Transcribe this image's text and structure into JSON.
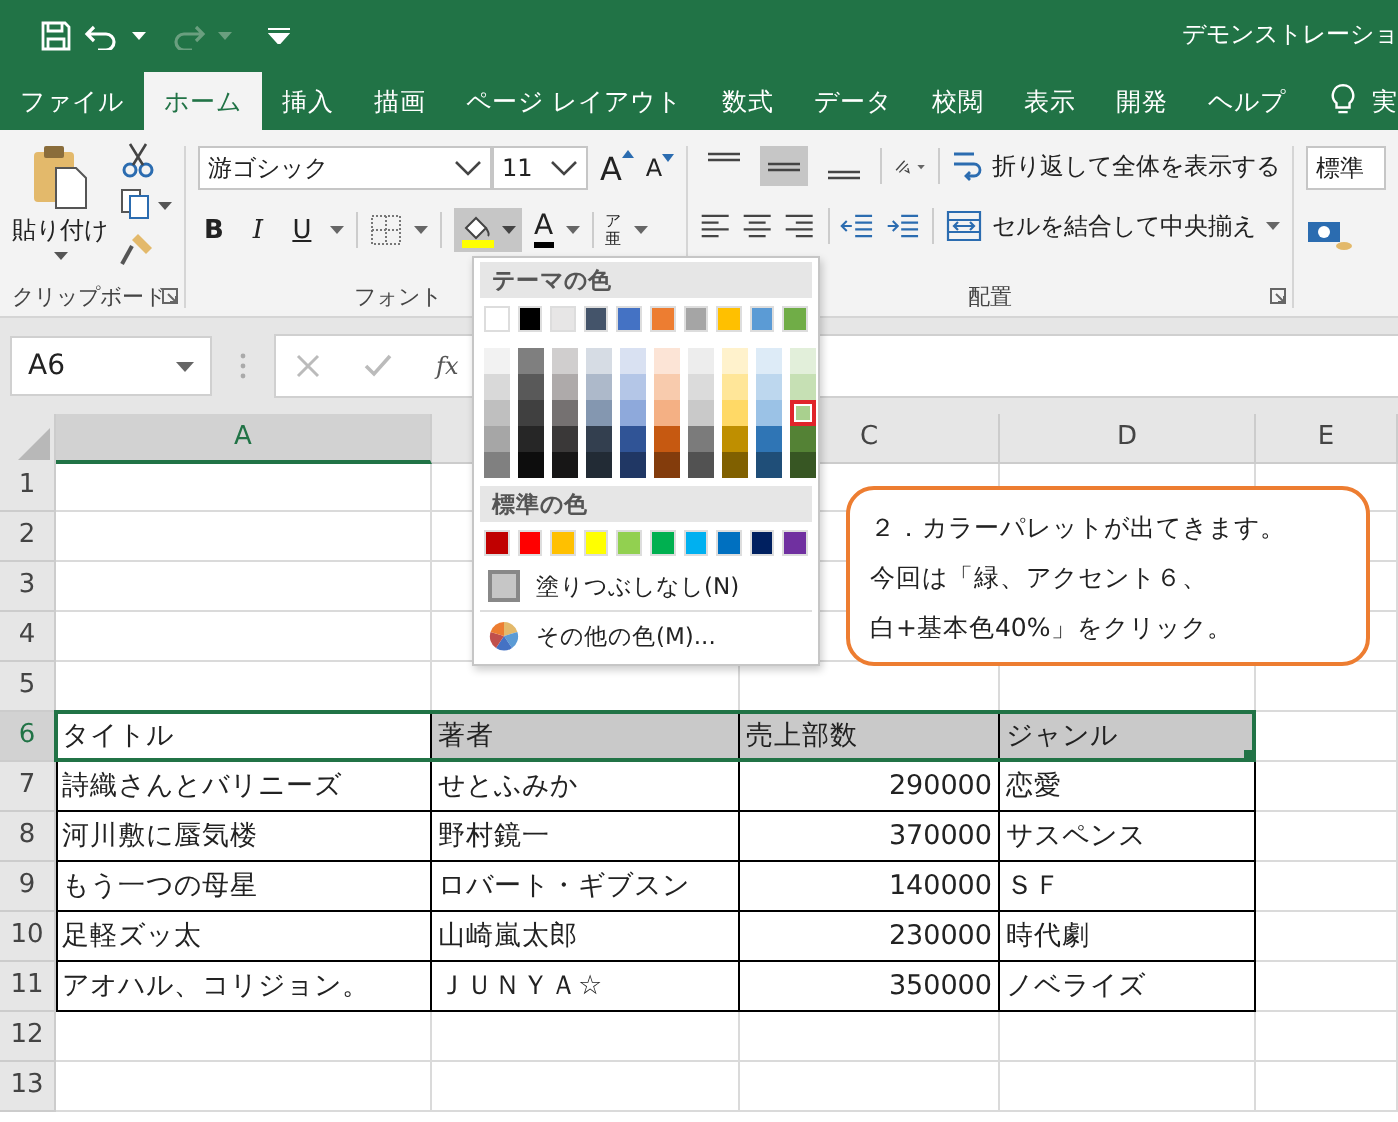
{
  "title_bar": {
    "title": "デモンストレーショ"
  },
  "ribbon_tabs": [
    {
      "label": "ファイル",
      "selected": false
    },
    {
      "label": "ホーム",
      "selected": true
    },
    {
      "label": "挿入",
      "selected": false
    },
    {
      "label": "描画",
      "selected": false
    },
    {
      "label": "ページ レイアウト",
      "selected": false
    },
    {
      "label": "数式",
      "selected": false
    },
    {
      "label": "データ",
      "selected": false
    },
    {
      "label": "校閲",
      "selected": false
    },
    {
      "label": "表示",
      "selected": false
    },
    {
      "label": "開発",
      "selected": false
    },
    {
      "label": "ヘルプ",
      "selected": false
    }
  ],
  "tell_me": "実",
  "ribbon": {
    "clipboard": {
      "paste": "貼り付け",
      "label": "クリップボード"
    },
    "font": {
      "name": "游ゴシック",
      "size": "11",
      "grow": "A",
      "shrink": "A",
      "bold": "B",
      "italic": "I",
      "underline": "U",
      "font_color": "A",
      "phonetic_top": "ア",
      "phonetic_bottom": "亜",
      "fill_menu_open": true,
      "label": "フォント"
    },
    "alignment": {
      "valign_buttons": [
        {
          "kind": "top",
          "selected": false
        },
        {
          "kind": "middle",
          "selected": true
        },
        {
          "kind": "bottom",
          "selected": false
        }
      ],
      "wrap": "折り返して全体を表示する",
      "merge": "セルを結合して中央揃え",
      "label": "配置"
    },
    "number": {
      "format": "標準"
    }
  },
  "formula_bar": {
    "name_box": "A6",
    "function_label": "fx"
  },
  "sheet": {
    "columns": [
      {
        "label": "A",
        "selected": true
      },
      {
        "selected": false
      },
      {
        "label": "C",
        "selected": false
      },
      {
        "label": "D",
        "selected": false
      },
      {
        "label": "E",
        "selected": false
      }
    ],
    "rows": [
      {
        "number": "1",
        "selected": false
      },
      {
        "number": "2",
        "selected": false
      },
      {
        "number": "3",
        "selected": false
      },
      {
        "number": "4",
        "selected": false
      },
      {
        "number": "5",
        "selected": false
      },
      {
        "number": "6",
        "selected": true,
        "cells": [
          {
            "text": "タイトル",
            "kind": "text",
            "shaded": false
          },
          {
            "text": "著者",
            "kind": "text",
            "shaded": true
          },
          {
            "text": "売上部数",
            "kind": "text",
            "shaded": true
          },
          {
            "text": "ジャンル",
            "kind": "text",
            "shaded": true
          }
        ]
      },
      {
        "number": "7",
        "selected": false,
        "cells": [
          {
            "text": "詩織さんとバリニーズ",
            "kind": "text",
            "shaded": false
          },
          {
            "text": "せとふみか",
            "kind": "text",
            "shaded": false
          },
          {
            "text": "290000",
            "kind": "number",
            "shaded": false
          },
          {
            "text": "恋愛",
            "kind": "text",
            "shaded": false
          }
        ]
      },
      {
        "number": "8",
        "selected": false,
        "cells": [
          {
            "text": "河川敷に蜃気楼",
            "kind": "text",
            "shaded": false
          },
          {
            "text": "野村鏡一",
            "kind": "text",
            "shaded": false
          },
          {
            "text": "370000",
            "kind": "number",
            "shaded": false
          },
          {
            "text": "サスペンス",
            "kind": "text",
            "shaded": false
          }
        ]
      },
      {
        "number": "9",
        "selected": false,
        "cells": [
          {
            "text": "もう一つの母星",
            "kind": "text",
            "shaded": false
          },
          {
            "text": "ロバート・ギブスン",
            "kind": "text",
            "shaded": false
          },
          {
            "text": "140000",
            "kind": "number",
            "shaded": false
          },
          {
            "text": "ＳＦ",
            "kind": "text",
            "shaded": false
          }
        ]
      },
      {
        "number": "10",
        "selected": false,
        "cells": [
          {
            "text": "足軽ズッ太",
            "kind": "text",
            "shaded": false
          },
          {
            "text": "山崎嵐太郎",
            "kind": "text",
            "shaded": false
          },
          {
            "text": "230000",
            "kind": "number",
            "shaded": false
          },
          {
            "text": "時代劇",
            "kind": "text",
            "shaded": false
          }
        ]
      },
      {
        "number": "11",
        "selected": false,
        "cells": [
          {
            "text": "アオハル、コリジョン。",
            "kind": "text",
            "shaded": false
          },
          {
            "text": "ＪＵＮＹＡ☆",
            "kind": "text",
            "shaded": false
          },
          {
            "text": "350000",
            "kind": "number",
            "shaded": false
          },
          {
            "text": "ノベライズ",
            "kind": "text",
            "shaded": false
          }
        ]
      },
      {
        "number": "12",
        "selected": false
      },
      {
        "number": "13",
        "selected": false
      }
    ]
  },
  "color_palette": {
    "theme_heading": "テーマの色",
    "theme_colors": [
      {
        "color": "#ffffff"
      },
      {
        "color": "#000000"
      },
      {
        "color": "#e7e6e6"
      },
      {
        "color": "#44546a"
      },
      {
        "color": "#4472c4"
      },
      {
        "color": "#ed7d31"
      },
      {
        "color": "#a5a5a5"
      },
      {
        "color": "#ffc000"
      },
      {
        "color": "#5b9bd5"
      },
      {
        "color": "#70ad47"
      }
    ],
    "theme_shades": [
      [
        {
          "color": "#f2f2f2",
          "selected": false
        },
        {
          "color": "#d9d9d9",
          "selected": false
        },
        {
          "color": "#bfbfbf",
          "selected": false
        },
        {
          "color": "#a6a6a6",
          "selected": false
        },
        {
          "color": "#808080",
          "selected": false
        }
      ],
      [
        {
          "color": "#7f7f7f",
          "selected": false
        },
        {
          "color": "#595959",
          "selected": false
        },
        {
          "color": "#404040",
          "selected": false
        },
        {
          "color": "#262626",
          "selected": false
        },
        {
          "color": "#0d0d0d",
          "selected": false
        }
      ],
      [
        {
          "color": "#d0cece",
          "selected": false
        },
        {
          "color": "#aeaaaa",
          "selected": false
        },
        {
          "color": "#757171",
          "selected": false
        },
        {
          "color": "#3a3838",
          "selected": false
        },
        {
          "color": "#171616",
          "selected": false
        }
      ],
      [
        {
          "color": "#d6dce4",
          "selected": false
        },
        {
          "color": "#adb9ca",
          "selected": false
        },
        {
          "color": "#8497b0",
          "selected": false
        },
        {
          "color": "#333f4f",
          "selected": false
        },
        {
          "color": "#222b35",
          "selected": false
        }
      ],
      [
        {
          "color": "#d9e1f2",
          "selected": false
        },
        {
          "color": "#b4c6e7",
          "selected": false
        },
        {
          "color": "#8ea9db",
          "selected": false
        },
        {
          "color": "#305496",
          "selected": false
        },
        {
          "color": "#203764",
          "selected": false
        }
      ],
      [
        {
          "color": "#fce4d6",
          "selected": false
        },
        {
          "color": "#f8cbad",
          "selected": false
        },
        {
          "color": "#f4b084",
          "selected": false
        },
        {
          "color": "#c65911",
          "selected": false
        },
        {
          "color": "#833c0c",
          "selected": false
        }
      ],
      [
        {
          "color": "#ededed",
          "selected": false
        },
        {
          "color": "#dbdbdb",
          "selected": false
        },
        {
          "color": "#c9c9c9",
          "selected": false
        },
        {
          "color": "#7b7b7b",
          "selected": false
        },
        {
          "color": "#525252",
          "selected": false
        }
      ],
      [
        {
          "color": "#fff2cc",
          "selected": false
        },
        {
          "color": "#ffe699",
          "selected": false
        },
        {
          "color": "#ffd966",
          "selected": false
        },
        {
          "color": "#bf8f00",
          "selected": false
        },
        {
          "color": "#806000",
          "selected": false
        }
      ],
      [
        {
          "color": "#ddebf7",
          "selected": false
        },
        {
          "color": "#bdd7ee",
          "selected": false
        },
        {
          "color": "#9bc2e6",
          "selected": false
        },
        {
          "color": "#2f75b5",
          "selected": false
        },
        {
          "color": "#1f4e78",
          "selected": false
        }
      ],
      [
        {
          "color": "#e2efda",
          "selected": false
        },
        {
          "color": "#c6e0b4",
          "selected": false
        },
        {
          "color": "#a9d08e",
          "selected": true
        },
        {
          "color": "#548235",
          "selected": false
        },
        {
          "color": "#375623",
          "selected": false
        }
      ]
    ],
    "standard_heading": "標準の色",
    "standard_colors": [
      {
        "color": "#c00000"
      },
      {
        "color": "#ff0000"
      },
      {
        "color": "#ffc000"
      },
      {
        "color": "#ffff00"
      },
      {
        "color": "#92d050"
      },
      {
        "color": "#00b050"
      },
      {
        "color": "#00b0f0"
      },
      {
        "color": "#0070c0"
      },
      {
        "color": "#002060"
      },
      {
        "color": "#7030a0"
      }
    ],
    "no_fill": "塗りつぶしなし(N)",
    "more_colors": "その他の色(M)..."
  },
  "callout": {
    "lines": [
      "２．カラーパレットが出てきます。",
      "今回は「緑、アクセント６、",
      "白+基本色40%」をクリック。"
    ]
  }
}
